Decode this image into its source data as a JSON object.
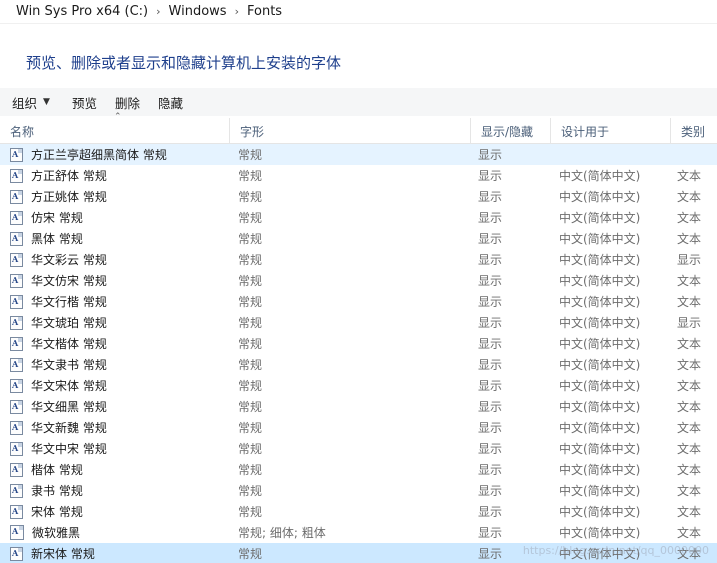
{
  "breadcrumb": {
    "items": [
      "Win Sys Pro x64 (C:)",
      "Windows",
      "Fonts"
    ],
    "separator": "›"
  },
  "heading": "预览、删除或者显示和隐藏计算机上安装的字体",
  "toolbar": {
    "organize": "组织",
    "preview": "预览",
    "delete": "删除",
    "hide": "隐藏"
  },
  "columns": {
    "name": "名称",
    "style": "字形",
    "show_hide": "显示/隐藏",
    "designed_for": "设计用于",
    "category": "类别"
  },
  "rows": [
    {
      "name": "方正兰亭超细黑简体 常规",
      "style": "常规",
      "show": "显示",
      "design": "",
      "cat": "",
      "selected": "light"
    },
    {
      "name": "方正舒体 常规",
      "style": "常规",
      "show": "显示",
      "design": "中文(简体中文)",
      "cat": "文本"
    },
    {
      "name": "方正姚体 常规",
      "style": "常规",
      "show": "显示",
      "design": "中文(简体中文)",
      "cat": "文本"
    },
    {
      "name": "仿宋 常规",
      "style": "常规",
      "show": "显示",
      "design": "中文(简体中文)",
      "cat": "文本"
    },
    {
      "name": "黑体 常规",
      "style": "常规",
      "show": "显示",
      "design": "中文(简体中文)",
      "cat": "文本"
    },
    {
      "name": "华文彩云 常规",
      "style": "常规",
      "show": "显示",
      "design": "中文(简体中文)",
      "cat": "显示"
    },
    {
      "name": "华文仿宋 常规",
      "style": "常规",
      "show": "显示",
      "design": "中文(简体中文)",
      "cat": "文本"
    },
    {
      "name": "华文行楷 常规",
      "style": "常规",
      "show": "显示",
      "design": "中文(简体中文)",
      "cat": "文本"
    },
    {
      "name": "华文琥珀 常规",
      "style": "常规",
      "show": "显示",
      "design": "中文(简体中文)",
      "cat": "显示"
    },
    {
      "name": "华文楷体 常规",
      "style": "常规",
      "show": "显示",
      "design": "中文(简体中文)",
      "cat": "文本"
    },
    {
      "name": "华文隶书 常规",
      "style": "常规",
      "show": "显示",
      "design": "中文(简体中文)",
      "cat": "文本"
    },
    {
      "name": "华文宋体 常规",
      "style": "常规",
      "show": "显示",
      "design": "中文(简体中文)",
      "cat": "文本"
    },
    {
      "name": "华文细黑 常规",
      "style": "常规",
      "show": "显示",
      "design": "中文(简体中文)",
      "cat": "文本"
    },
    {
      "name": "华文新魏 常规",
      "style": "常规",
      "show": "显示",
      "design": "中文(简体中文)",
      "cat": "文本"
    },
    {
      "name": "华文中宋 常规",
      "style": "常规",
      "show": "显示",
      "design": "中文(简体中文)",
      "cat": "文本"
    },
    {
      "name": "楷体 常规",
      "style": "常规",
      "show": "显示",
      "design": "中文(简体中文)",
      "cat": "文本"
    },
    {
      "name": "隶书 常规",
      "style": "常规",
      "show": "显示",
      "design": "中文(简体中文)",
      "cat": "文本"
    },
    {
      "name": "宋体 常规",
      "style": "常规",
      "show": "显示",
      "design": "中文(简体中文)",
      "cat": "文本"
    },
    {
      "name": "微软雅黑",
      "style": "常规; 细体; 粗体",
      "show": "显示",
      "design": "中文(简体中文)",
      "cat": "文本",
      "icon": "big"
    },
    {
      "name": "新宋体 常规",
      "style": "常规",
      "show": "显示",
      "design": "中文(简体中文)",
      "cat": "文本",
      "selected": "strong"
    }
  ],
  "watermark": "https://blog.csdn.net/qq_0000000"
}
